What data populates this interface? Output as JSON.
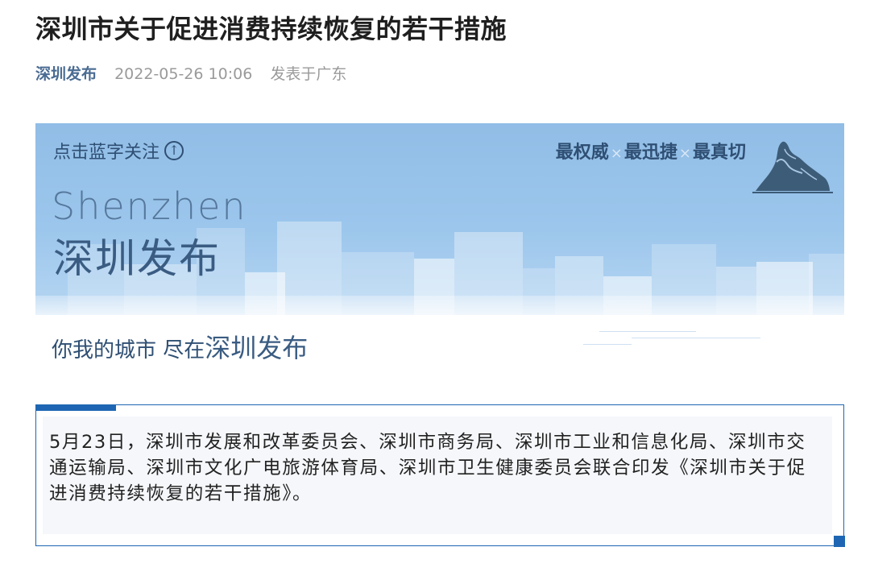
{
  "article": {
    "title": "深圳市关于促进消费持续恢复的若干措施",
    "account": "深圳发布",
    "date": "2022-05-26 10:06",
    "location": "发表于广东"
  },
  "banner": {
    "follow_text": "点击蓝字关注",
    "follow_icon": "up-arrow-circle-icon",
    "slogan_1": "最权威",
    "slogan_2": "最迅捷",
    "slogan_3": "最真切",
    "separator": "×",
    "name_en": "Shenzhen",
    "name_cn": "深圳发布",
    "tagline_prefix": "你我的城市 尽在",
    "tagline_brand": "深圳发布",
    "mascot_icon": "mountain-rock-logo-icon"
  },
  "quote": {
    "text": "5月23日，深圳市发展和改革委员会、深圳市商务局、深圳市工业和信息化局、深圳市交通运输局、深圳市文化广电旅游体育局、深圳市卫生健康委员会联合印发《深圳市关于促进消费持续恢复的若干措施》。"
  },
  "colors": {
    "accent_blue": "#1e66b3",
    "account_link": "#4a6b93",
    "banner_sky": "#9cc6ec",
    "banner_text": "#2f4f73"
  }
}
